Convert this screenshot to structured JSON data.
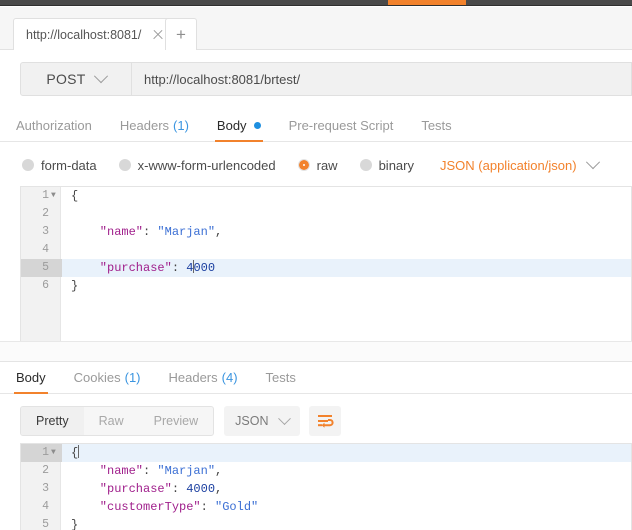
{
  "window": {
    "topbar_accent_color": "#f2822c"
  },
  "tabbar": {
    "tab_label": "http://localhost:8081/",
    "close_icon": "close-icon",
    "new_tab_label": "+"
  },
  "url_row": {
    "method": "POST",
    "url": "http://localhost:8081/brtest/"
  },
  "request_tabs": [
    {
      "label": "Authorization",
      "count": "",
      "active": false
    },
    {
      "label": "Headers",
      "count": "(1)",
      "active": false
    },
    {
      "label": "Body",
      "count": "",
      "active": true,
      "dot": true
    },
    {
      "label": "Pre-request Script",
      "count": "",
      "active": false
    },
    {
      "label": "Tests",
      "count": "",
      "active": false
    }
  ],
  "body_types": [
    {
      "label": "form-data",
      "checked": false
    },
    {
      "label": "x-www-form-urlencoded",
      "checked": false
    },
    {
      "label": "raw",
      "checked": true
    },
    {
      "label": "binary",
      "checked": false
    }
  ],
  "body_format": {
    "label": "JSON (application/json)",
    "color": "#f2822c"
  },
  "request_body": {
    "lines": [
      {
        "num": "1",
        "fold": true,
        "highlight": false,
        "tokens": [
          {
            "t": "{",
            "c": "p"
          }
        ]
      },
      {
        "num": "2",
        "fold": false,
        "highlight": false,
        "tokens": []
      },
      {
        "num": "3",
        "fold": false,
        "highlight": false,
        "tokens": [
          {
            "t": "    \"name\"",
            "c": "k"
          },
          {
            "t": ": ",
            "c": "p"
          },
          {
            "t": "\"Marjan\"",
            "c": "s"
          },
          {
            "t": ",",
            "c": "p"
          }
        ]
      },
      {
        "num": "4",
        "fold": false,
        "highlight": false,
        "tokens": []
      },
      {
        "num": "5",
        "fold": false,
        "highlight": true,
        "tokens": [
          {
            "t": "    \"purchase\"",
            "c": "k"
          },
          {
            "t": ": ",
            "c": "p"
          },
          {
            "t": "4",
            "c": "n"
          },
          {
            "t": "|caret|",
            "c": "caret"
          },
          {
            "t": "000",
            "c": "n"
          }
        ]
      },
      {
        "num": "6",
        "fold": false,
        "highlight": false,
        "tokens": [
          {
            "t": "}",
            "c": "p"
          }
        ]
      }
    ]
  },
  "response_tabs": [
    {
      "label": "Body",
      "count": "",
      "active": true
    },
    {
      "label": "Cookies",
      "count": "(1)",
      "active": false
    },
    {
      "label": "Headers",
      "count": "(4)",
      "active": false
    },
    {
      "label": "Tests",
      "count": "",
      "active": false
    }
  ],
  "response_toolbar": {
    "segments": [
      {
        "label": "Pretty",
        "active": true
      },
      {
        "label": "Raw",
        "active": false
      },
      {
        "label": "Preview",
        "active": false
      }
    ],
    "format": "JSON",
    "wrap_icon": "word-wrap-icon",
    "wrap_icon_color": "#f2822c"
  },
  "response_body": {
    "lines": [
      {
        "num": "1",
        "fold": true,
        "highlight": true,
        "tokens": [
          {
            "t": "{",
            "c": "p"
          },
          {
            "t": "|caret|",
            "c": "caret"
          }
        ]
      },
      {
        "num": "2",
        "fold": false,
        "highlight": false,
        "tokens": [
          {
            "t": "    \"name\"",
            "c": "k"
          },
          {
            "t": ": ",
            "c": "p"
          },
          {
            "t": "\"Marjan\"",
            "c": "s"
          },
          {
            "t": ",",
            "c": "p"
          }
        ]
      },
      {
        "num": "3",
        "fold": false,
        "highlight": false,
        "tokens": [
          {
            "t": "    \"purchase\"",
            "c": "k"
          },
          {
            "t": ": ",
            "c": "p"
          },
          {
            "t": "4000",
            "c": "n"
          },
          {
            "t": ",",
            "c": "p"
          }
        ]
      },
      {
        "num": "4",
        "fold": false,
        "highlight": false,
        "tokens": [
          {
            "t": "    \"customerType\"",
            "c": "k"
          },
          {
            "t": ": ",
            "c": "p"
          },
          {
            "t": "\"Gold\"",
            "c": "s"
          }
        ]
      },
      {
        "num": "5",
        "fold": false,
        "highlight": false,
        "tokens": [
          {
            "t": "}",
            "c": "p"
          }
        ]
      }
    ]
  }
}
